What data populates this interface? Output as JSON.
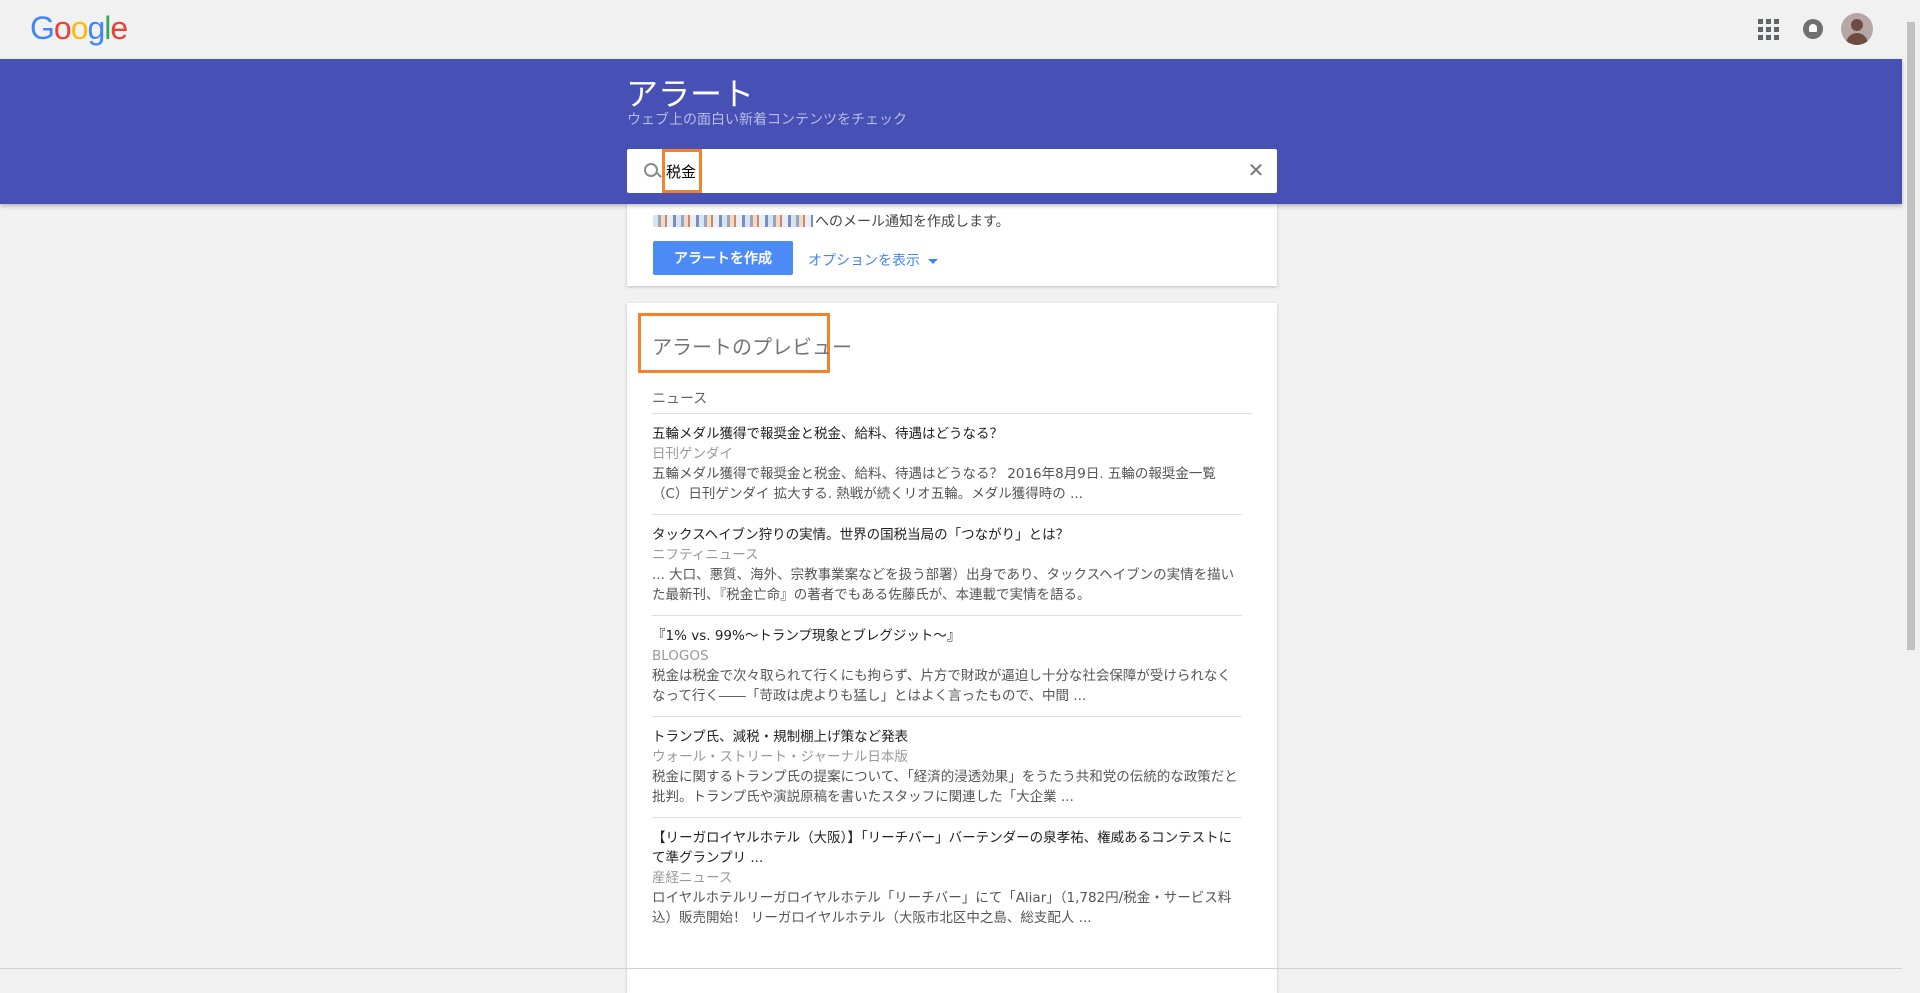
{
  "logo": [
    "G",
    "o",
    "o",
    "g",
    "l",
    "e"
  ],
  "header": {
    "icons": [
      "apps-icon",
      "notifications-icon",
      "account-avatar"
    ]
  },
  "hero": {
    "title": "アラート",
    "subtitle": "ウェブ上の面白い新着コンテンツをチェック"
  },
  "search": {
    "value": "税金",
    "clear_label": "✕"
  },
  "create": {
    "notify_suffix": "へのメール通知を作成します。",
    "create_button": "アラートを作成",
    "options_link": "オプションを表示"
  },
  "preview": {
    "title": "アラートのプレビュー",
    "section_label": "ニュース",
    "articles": [
      {
        "title": "五輪メダル獲得で報奨金と税金、給料、待遇はどうなる？",
        "source": "日刊ゲンダイ",
        "snippet": "五輪メダル獲得で報奨金と税金、給料、待遇はどうなる？ 2016年8月9日. 五輪の報奨金一覧（C）日刊ゲンダイ 拡大する. 熱戦が続くリオ五輪。メダル獲得時の ..."
      },
      {
        "title": "タックスヘイブン狩りの実情。世界の国税当局の「つながり」とは？",
        "source": "ニフティニュース",
        "snippet": "... 大口、悪質、海外、宗教事業案などを扱う部署）出身であり、タックスヘイブンの実情を描いた最新刊、『税金亡命』の著者でもある佐藤氏が、本連載で実情を語る。"
      },
      {
        "title": "『1% vs. 99%〜トランプ現象とブレグジット〜』",
        "source": "BLOGOS",
        "snippet": "税金は税金で次々取られて行くにも拘らず、片方で財政が逼迫し十分な社会保障が受けられなくなって行く――「苛政は虎よりも猛し」とはよく言ったもので、中間 ..."
      },
      {
        "title": "トランプ氏、減税・規制棚上げ策など発表",
        "source": "ウォール・ストリート・ジャーナル日本版",
        "snippet": "税金に関するトランプ氏の提案について、「経済的浸透効果」をうたう共和党の伝統的な政策だと批判。トランプ氏や演説原稿を書いたスタッフに関連した「大企業 ..."
      },
      {
        "title": "【リーガロイヤルホテル（大阪）】「リーチバー」バーテンダーの泉孝祐、権威あるコンテストにて準グランプリ ...",
        "source": "産経ニュース",
        "snippet": "ロイヤルホテルリーガロイヤルホテル「リーチバー」にて「Aliar」（1,782円/税金・サービス料込）販売開始！ リーガロイヤルホテル（大阪市北区中之島、総支配人 ..."
      }
    ]
  },
  "colors": {
    "hero_bg": "#4650b5",
    "accent": "#4c8bf5",
    "highlight": "#f5822a"
  }
}
